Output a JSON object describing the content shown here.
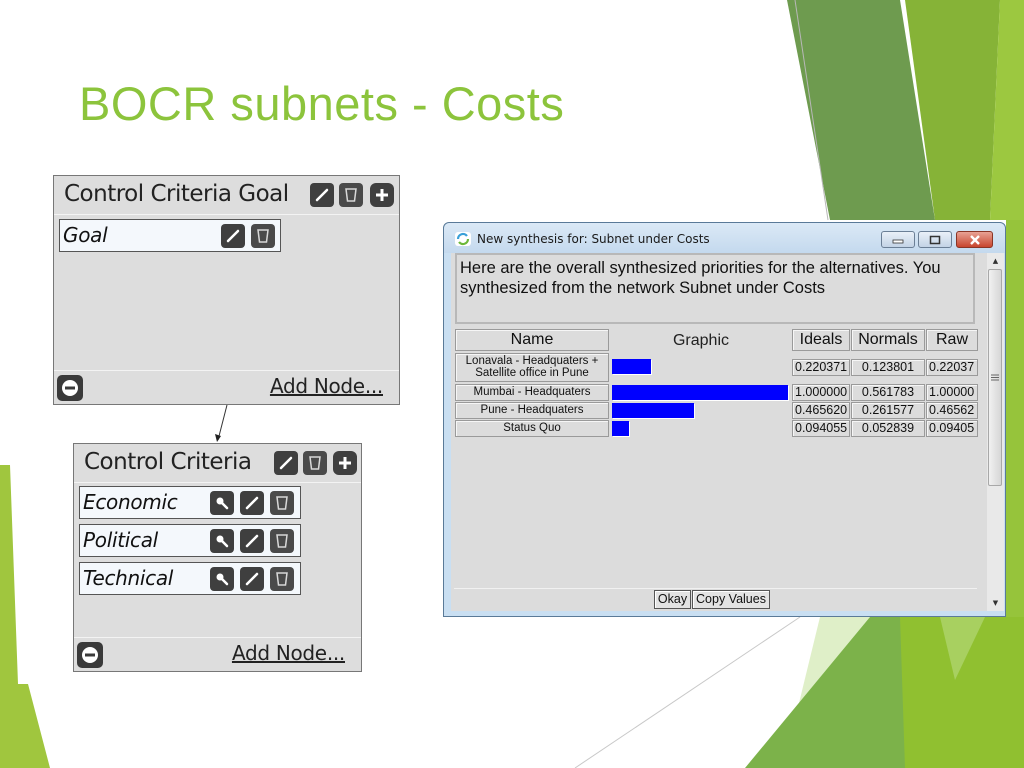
{
  "slide": {
    "title": "BOCR subnets - Costs",
    "accent_color": "#8cc43c"
  },
  "goal_panel": {
    "title": "Control Criteria Goal",
    "header_icons": [
      "edit-icon",
      "trash-icon",
      "plus-icon"
    ],
    "nodes": [
      {
        "label": "Goal",
        "icons": [
          "edit-icon",
          "trash-icon"
        ]
      }
    ],
    "footer": {
      "collapse_icon": "minus-circle-icon",
      "add_node_label": "Add Node..."
    }
  },
  "criteria_panel": {
    "title": "Control Criteria",
    "header_icons": [
      "edit-icon",
      "trash-icon",
      "plus-icon"
    ],
    "nodes": [
      {
        "label": "Economic",
        "icons": [
          "magnifier-icon",
          "edit-icon",
          "trash-icon"
        ]
      },
      {
        "label": "Political",
        "icons": [
          "magnifier-icon",
          "edit-icon",
          "trash-icon"
        ]
      },
      {
        "label": "Technical",
        "icons": [
          "magnifier-icon",
          "edit-icon",
          "trash-icon"
        ]
      }
    ],
    "footer": {
      "collapse_icon": "minus-circle-icon",
      "add_node_label": "Add Node..."
    }
  },
  "window": {
    "title": "New synthesis for: Subnet under Costs",
    "message": "Here are the overall synthesized priorities for the alternatives.  You synthesized from the network Subnet under Costs",
    "columns": {
      "name": "Name",
      "graphic": "Graphic",
      "ideals": "Ideals",
      "normals": "Normals",
      "raw": "Raw"
    },
    "rows": [
      {
        "name_line1": "Lonavala - Headquaters +",
        "name_line2": "Satellite office in Pune",
        "ideal": 0.220371,
        "ideals": "0.220371",
        "normals": "0.123801",
        "raw": "0.22037"
      },
      {
        "name_line1": "Mumbai - Headquaters",
        "name_line2": "",
        "ideal": 1.0,
        "ideals": "1.000000",
        "normals": "0.561783",
        "raw": "1.00000"
      },
      {
        "name_line1": "Pune - Headquaters",
        "name_line2": "",
        "ideal": 0.46562,
        "ideals": "0.465620",
        "normals": "0.261577",
        "raw": "0.46562"
      },
      {
        "name_line1": "Status Quo",
        "name_line2": "",
        "ideal": 0.094055,
        "ideals": "0.094055",
        "normals": "0.052839",
        "raw": "0.09405"
      }
    ],
    "bar_color": "#0000ff",
    "buttons": {
      "okay": "Okay",
      "copy": "Copy Values"
    }
  }
}
